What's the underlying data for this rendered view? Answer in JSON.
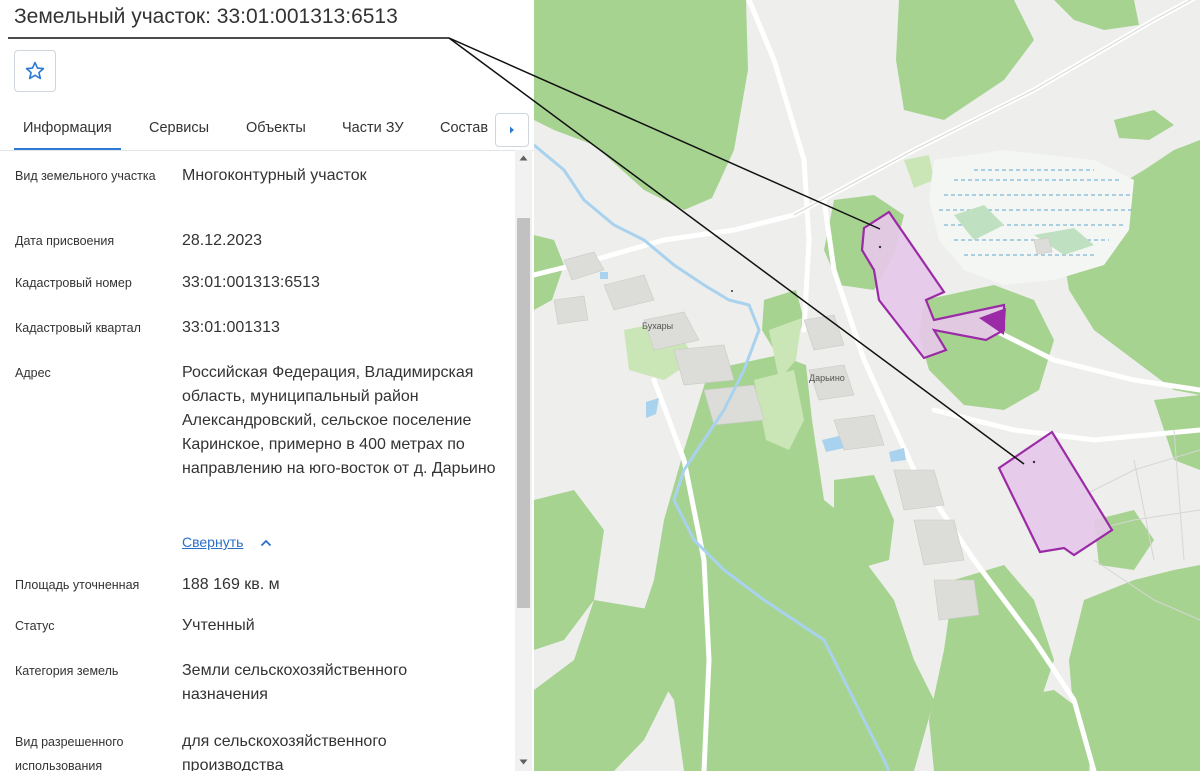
{
  "title": "Земельный участок: 33:01:001313:6513",
  "tabs": [
    {
      "label": "Информация",
      "active": true
    },
    {
      "label": "Сервисы",
      "active": false
    },
    {
      "label": "Объекты",
      "active": false
    },
    {
      "label": "Части ЗУ",
      "active": false
    },
    {
      "label": "Состав",
      "active": false
    }
  ],
  "fields": [
    {
      "label": "Вид земельного участка",
      "value": "Многоконтурный участок"
    },
    {
      "label": "Дата присвоения",
      "value": "28.12.2023"
    },
    {
      "label": "Кадастровый номер",
      "value": "33:01:001313:6513"
    },
    {
      "label": "Кадастровый квартал",
      "value": "33:01:001313"
    },
    {
      "label": "Адрес",
      "value": "Российская Федерация, Владимирская область, муниципальный район Александровский, сельское поселение Каринское, примерно в 400 метрах по направлению на юго-восток от д. Дарьино"
    },
    {
      "label": "Площадь уточненная",
      "value": "188 169 кв. м"
    },
    {
      "label": "Статус",
      "value": "Учтенный"
    },
    {
      "label": "Категория земель",
      "value": "Земли сельскохозяйственного назначения"
    },
    {
      "label": "Вид разрешенного использования",
      "value": "для сельскохозяйственного производства"
    }
  ],
  "collapse_link": "Свернуть",
  "map": {
    "labels": {
      "village1": "Бухары",
      "village2": "Дарьино"
    },
    "colors": {
      "background": "#eeeeec",
      "forest": "#a7d391",
      "parcel_fill": "#e6c8e9",
      "parcel_stroke": "#9b2aa6",
      "river": "#a8d2ee",
      "road": "#ffffff"
    }
  },
  "icons": {
    "favorite": "star-outline-icon",
    "tabs_next": "chevron-right-icon",
    "collapse": "chevron-up-icon"
  }
}
